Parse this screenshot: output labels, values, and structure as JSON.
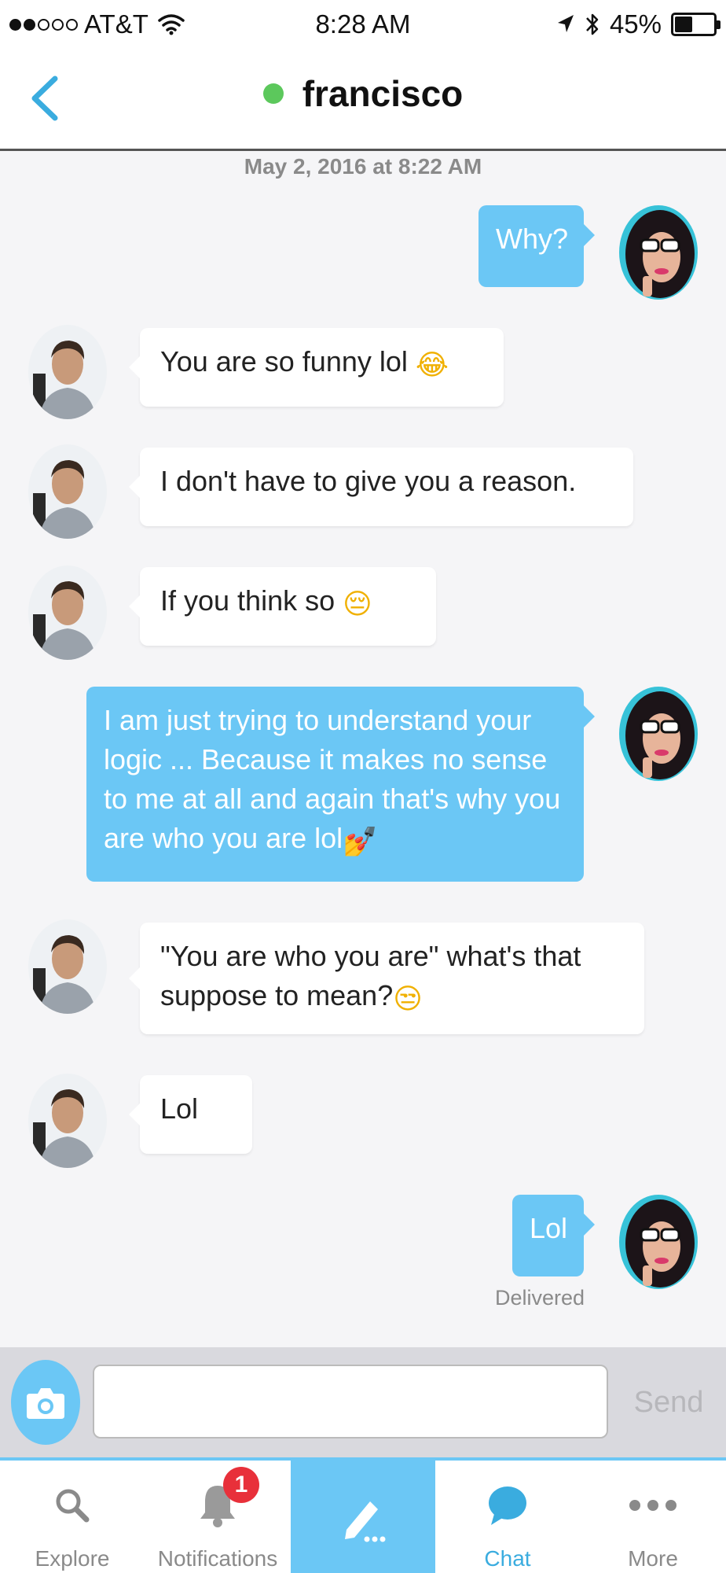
{
  "status_bar": {
    "carrier": "AT&T",
    "time": "8:28 AM",
    "battery_percent": "45%",
    "battery_level": 0.45,
    "signal_bars_filled": 2,
    "signal_bars_total": 5,
    "icons": [
      "wifi-icon",
      "location-arrow-icon",
      "bluetooth-icon",
      "battery-icon"
    ]
  },
  "header": {
    "back_icon": "chevron-left-icon",
    "contact_name": "francisco",
    "online_status_color": "#5cc85c"
  },
  "chat": {
    "timestamp": "May 2, 2016 at 8:22 AM",
    "messages": [
      {
        "from": "me",
        "text": "Why?"
      },
      {
        "from": "them",
        "text": "You are so funny lol",
        "emoji": "tears-of-joy"
      },
      {
        "from": "them",
        "text": "I don't have to give you a reason."
      },
      {
        "from": "them",
        "text": "If you think so",
        "emoji": "pensive-face"
      },
      {
        "from": "me",
        "text": "I am just trying to understand your logic ... Because it makes no sense to me at all and again that's why you are who you are lol",
        "emoji": "nail-polish"
      },
      {
        "from": "them",
        "text": "\"You are who you are\" what's that suppose to mean?",
        "emoji": "unamused-face"
      },
      {
        "from": "them",
        "text": "Lol"
      },
      {
        "from": "me",
        "text": "Lol"
      }
    ],
    "delivered_label": "Delivered"
  },
  "composer": {
    "input_value": "",
    "input_placeholder": "",
    "send_label": "Send"
  },
  "tabs": [
    {
      "label": "Explore",
      "icon": "search-icon"
    },
    {
      "label": "Notifications",
      "icon": "bell-icon",
      "badge": "1"
    },
    {
      "label": "",
      "icon": "compose-pencil-icon"
    },
    {
      "label": "Chat",
      "icon": "chat-bubble-icon",
      "active": true
    },
    {
      "label": "More",
      "icon": "more-dots-icon"
    }
  ],
  "colors": {
    "accent": "#6bc7f5",
    "active_tab_text": "#3aacdf",
    "badge": "#e8303a",
    "online": "#5cc85c"
  }
}
